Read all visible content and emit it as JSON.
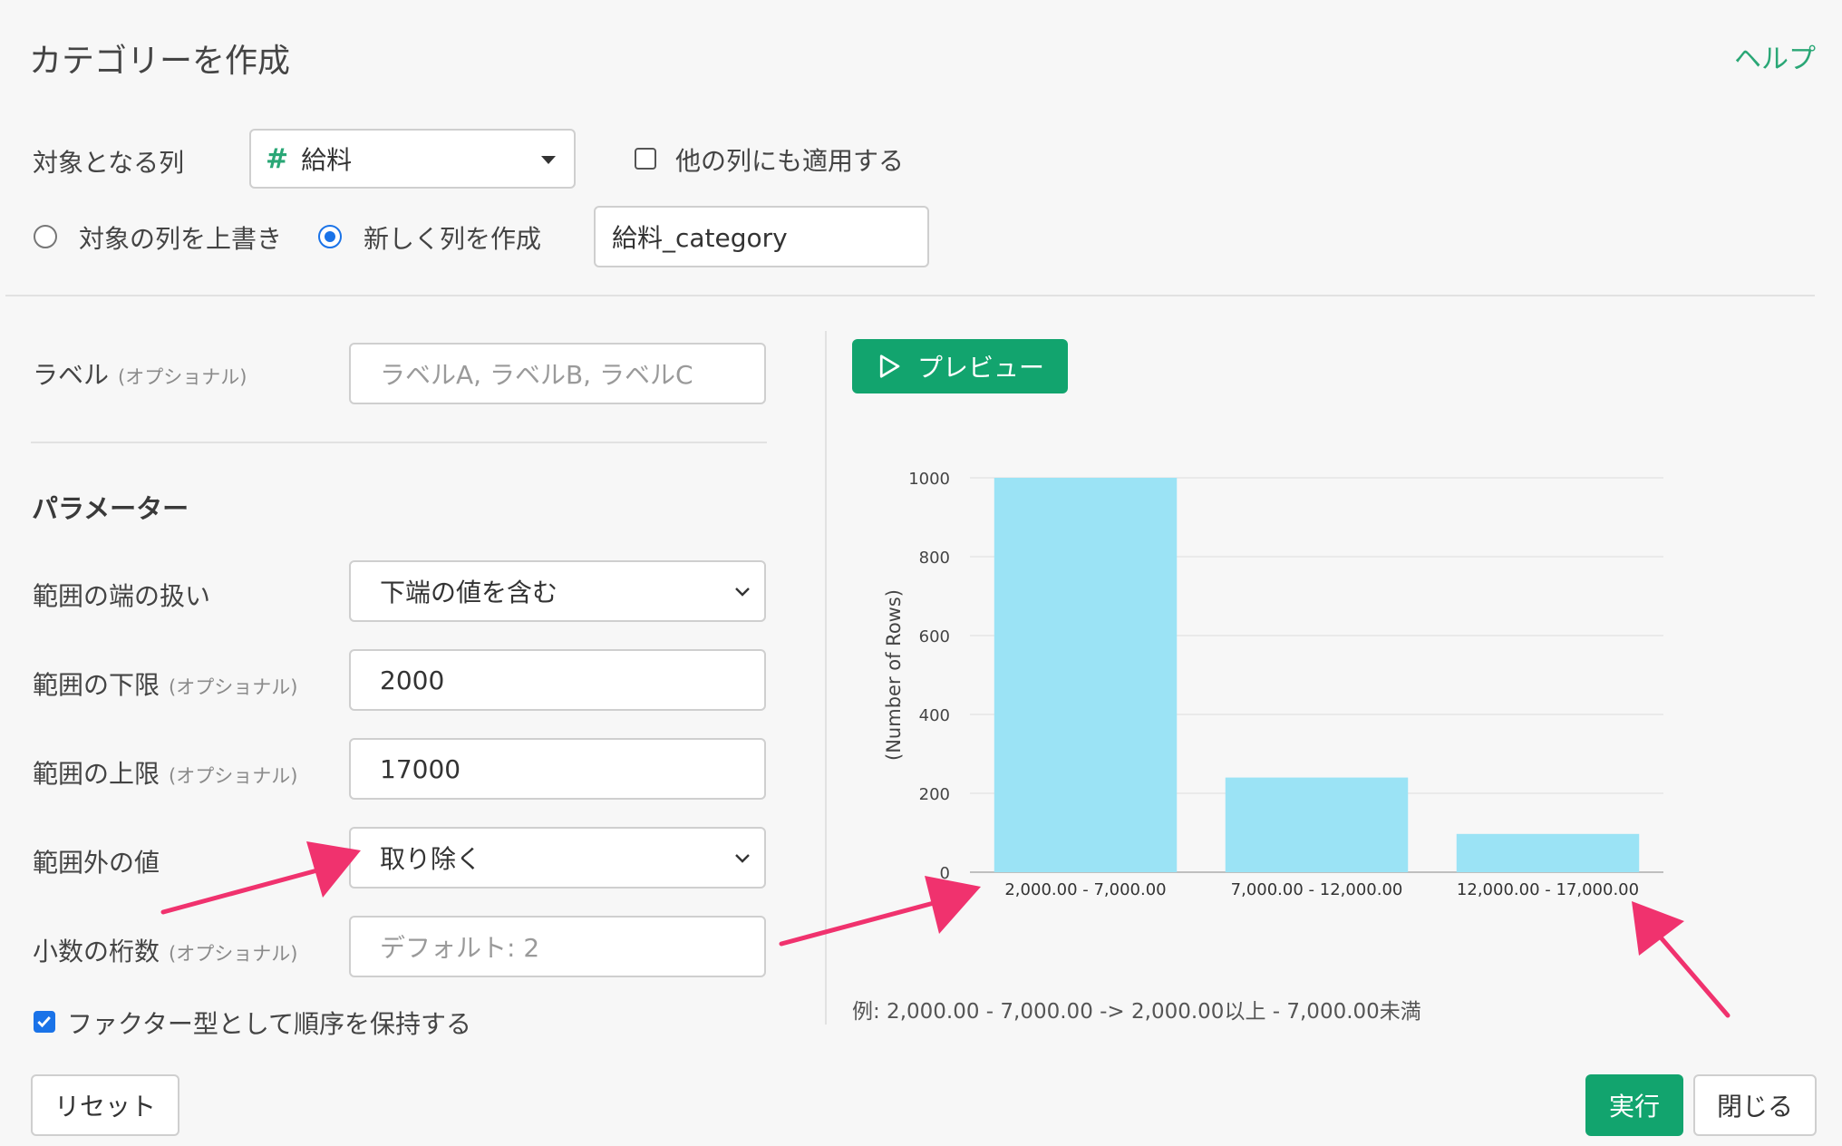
{
  "dialog": {
    "title": "カテゴリーを作成",
    "help_link": "ヘルプ"
  },
  "target": {
    "label": "対象となる列",
    "column_value": "給料",
    "column_type_icon": "#",
    "apply_others_label": "他の列にも適用する",
    "apply_others_checked": false,
    "overwrite_label": "対象の列を上書き",
    "overwrite_selected": false,
    "new_column_label": "新しく列を作成",
    "new_column_selected": true,
    "new_column_name": "給料_category"
  },
  "label_field": {
    "label": "ラベル",
    "optional": "(オプショナル)",
    "placeholder": "ラベルA, ラベルB, ラベルC"
  },
  "params": {
    "heading": "パラメーター",
    "range_edge_label": "範囲の端の扱い",
    "range_edge_value": "下端の値を含む",
    "lower_label": "範囲の下限",
    "lower_optional": "(オプショナル)",
    "lower_value": "2000",
    "upper_label": "範囲の上限",
    "upper_optional": "(オプショナル)",
    "upper_value": "17000",
    "outside_label": "範囲外の値",
    "outside_value": "取り除く",
    "decimals_label": "小数の桁数",
    "decimals_optional": "(オプショナル)",
    "decimals_placeholder": "デフォルト: 2",
    "factor_label": "ファクター型として順序を保持する",
    "factor_checked": true
  },
  "preview": {
    "button_label": "プレビュー",
    "example_note": "例: 2,000.00 - 7,000.00 -> 2,000.00以上 - 7,000.00未満"
  },
  "buttons": {
    "reset": "リセット",
    "run": "実行",
    "close": "閉じる"
  },
  "colors": {
    "accent_green": "#12a46e",
    "bar": "#9be3f5",
    "arrow": "#f0326e",
    "radio_blue": "#1a73e8"
  },
  "chart_data": {
    "type": "bar",
    "categories": [
      "2,000.00 - 7,000.00",
      "7,000.00 - 12,000.00",
      "12,000.00 - 17,000.00"
    ],
    "values": [
      1000,
      240,
      97
    ],
    "ylabel": "(Number of Rows)",
    "ylim": [
      0,
      1000
    ],
    "yticks": [
      "0",
      "200",
      "400",
      "600",
      "800",
      "1000"
    ],
    "grid": true
  }
}
